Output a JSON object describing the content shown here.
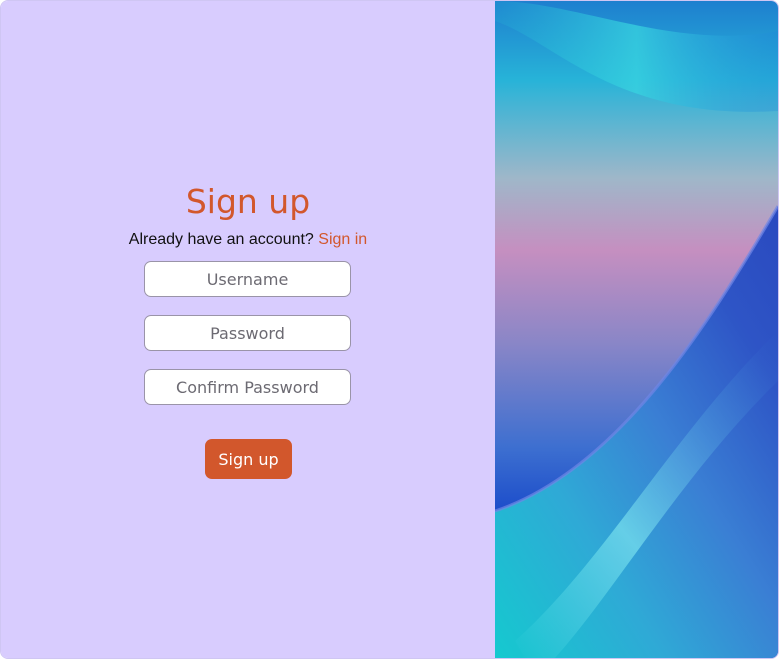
{
  "signup": {
    "title": "Sign up",
    "prompt": "Already have an account?",
    "signin_link": "Sign in",
    "fields": {
      "username_placeholder": "Username",
      "password_placeholder": "Password",
      "confirm_placeholder": "Confirm Password"
    },
    "submit_label": "Sign up"
  },
  "colors": {
    "panel_bg": "#d8ccfe",
    "accent": "#d2572c"
  }
}
